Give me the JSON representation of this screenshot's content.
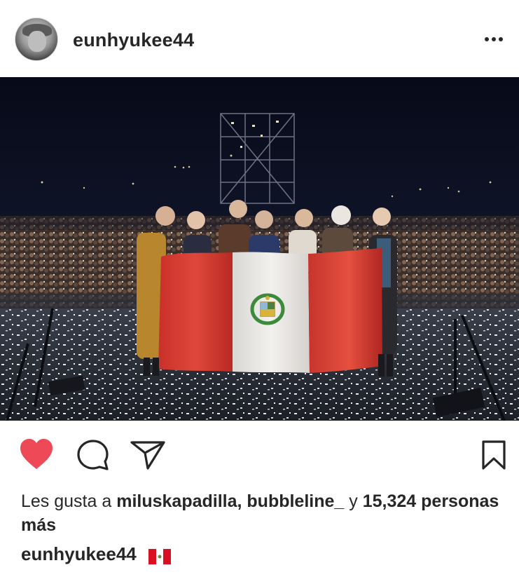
{
  "post": {
    "username": "eunhyukee44",
    "image_alt": "Group photo on stage holding the flag of Peru",
    "liked": true
  },
  "likes": {
    "prefix": "Les gusta a",
    "users": "miluskapadilla, bubbleline_",
    "conjunction": "y",
    "count": "15,324",
    "suffix": "personas más"
  },
  "caption": {
    "username": "eunhyukee44",
    "emoji": "flag-peru"
  },
  "icons": {
    "more": "more-dots-icon",
    "like": "heart-icon",
    "comment": "comment-icon",
    "share": "send-icon",
    "save": "bookmark-icon"
  },
  "colors": {
    "heart": "#ED4956",
    "text": "#262626",
    "flag_red": "#D91023"
  }
}
